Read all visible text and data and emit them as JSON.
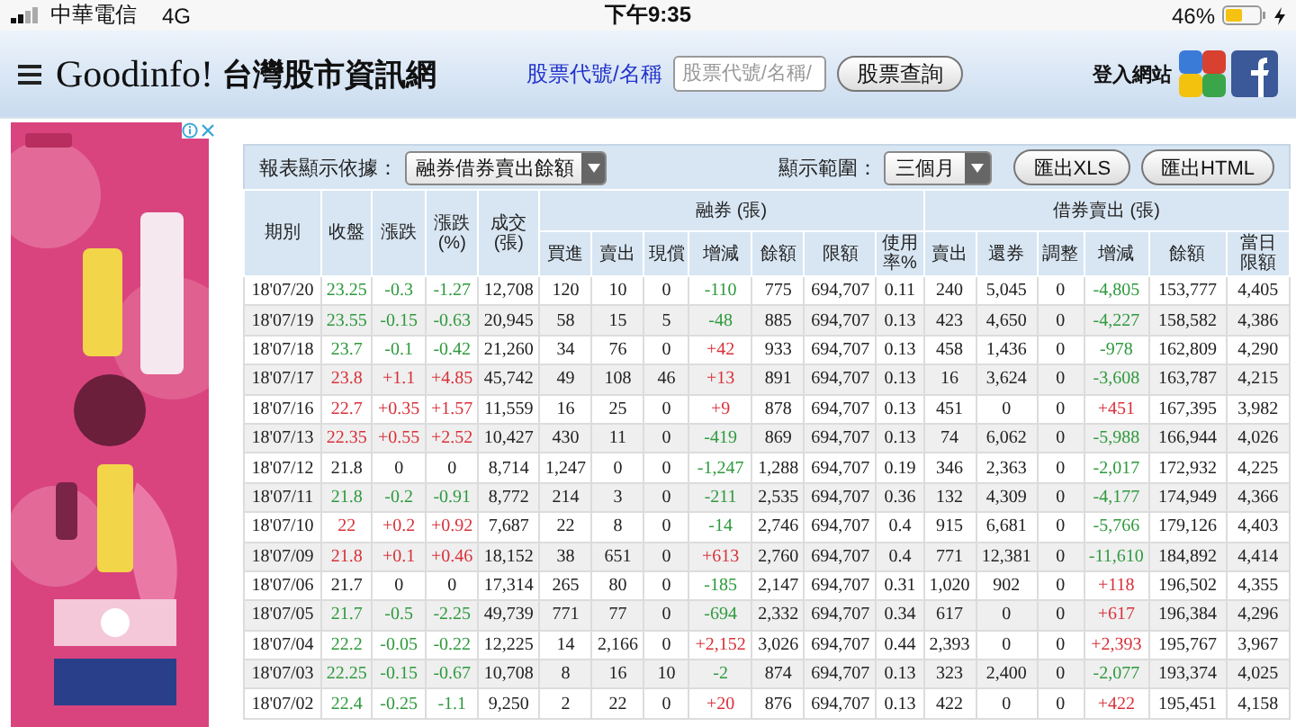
{
  "status_bar": {
    "carrier": "中華電信",
    "network": "4G",
    "time": "下午9:35",
    "battery": "46%"
  },
  "header": {
    "site_name": "Goodinfo!",
    "site_subtitle": "台灣股市資訊網",
    "search_label": "股票代號/名稱",
    "search_field": {
      "placeholder": "股票代號/名稱/"
    },
    "search_button": "股票查詢",
    "login": "登入網站"
  },
  "controls": {
    "basis_label": "報表顯示依據：",
    "basis_select": "融券借券賣出餘額",
    "range_label": "顯示範圍：",
    "range_select": "三個月",
    "buttons": [
      "匯出XLS",
      "匯出HTML"
    ]
  },
  "table": {
    "columns": [
      "期別",
      "收盤",
      "漲跌",
      "漲跌\n(%)",
      "成交\n(張)"
    ],
    "groups": [
      {
        "label": "融券 (張)",
        "columns": [
          "買進",
          "賣出",
          "現償",
          "增減",
          "餘額",
          "限額",
          "使用率%"
        ]
      },
      {
        "label": "借券賣出 (張)",
        "columns": [
          "賣出",
          "還券",
          "調整",
          "增減",
          "餘額",
          "當日限額"
        ]
      }
    ],
    "rows": [
      [
        "18'07/20",
        {
          "text": "23.25",
          "color": "#2f9a3e"
        },
        {
          "text": "-0.3",
          "color": "#2f9a3e"
        },
        {
          "text": "-1.27",
          "color": "#2f9a3e"
        },
        "12,708",
        "120",
        "10",
        "0",
        {
          "text": "-110",
          "color": "#2f9a3e"
        },
        "775",
        "694,707",
        "0.11",
        "240",
        "5,045",
        "0",
        {
          "text": "-4,805",
          "color": "#2f9a3e"
        },
        "153,777",
        "4,405"
      ],
      [
        "18'07/19",
        {
          "text": "23.55",
          "color": "#2f9a3e"
        },
        {
          "text": "-0.15",
          "color": "#2f9a3e"
        },
        {
          "text": "-0.63",
          "color": "#2f9a3e"
        },
        "20,945",
        "58",
        "15",
        "5",
        {
          "text": "-48",
          "color": "#2f9a3e"
        },
        "885",
        "694,707",
        "0.13",
        "423",
        "4,650",
        "0",
        {
          "text": "-4,227",
          "color": "#2f9a3e"
        },
        "158,582",
        "4,386"
      ],
      [
        "18'07/18",
        {
          "text": "23.7",
          "color": "#2f9a3e"
        },
        {
          "text": "-0.1",
          "color": "#2f9a3e"
        },
        {
          "text": "-0.42",
          "color": "#2f9a3e"
        },
        "21,260",
        "34",
        "76",
        "0",
        {
          "text": "+42",
          "color": "#d8323a"
        },
        "933",
        "694,707",
        "0.13",
        "458",
        "1,436",
        "0",
        {
          "text": "-978",
          "color": "#2f9a3e"
        },
        "162,809",
        "4,290"
      ],
      [
        "18'07/17",
        {
          "text": "23.8",
          "color": "#d8323a"
        },
        {
          "text": "+1.1",
          "color": "#d8323a"
        },
        {
          "text": "+4.85",
          "color": "#d8323a"
        },
        "45,742",
        "49",
        "108",
        "46",
        {
          "text": "+13",
          "color": "#d8323a"
        },
        "891",
        "694,707",
        "0.13",
        "16",
        "3,624",
        "0",
        {
          "text": "-3,608",
          "color": "#2f9a3e"
        },
        "163,787",
        "4,215"
      ],
      [
        "18'07/16",
        {
          "text": "22.7",
          "color": "#d8323a"
        },
        {
          "text": "+0.35",
          "color": "#d8323a"
        },
        {
          "text": "+1.57",
          "color": "#d8323a"
        },
        "11,559",
        "16",
        "25",
        "0",
        {
          "text": "+9",
          "color": "#d8323a"
        },
        "878",
        "694,707",
        "0.13",
        "451",
        "0",
        "0",
        {
          "text": "+451",
          "color": "#d8323a"
        },
        "167,395",
        "3,982"
      ],
      [
        "18'07/13",
        {
          "text": "22.35",
          "color": "#d8323a"
        },
        {
          "text": "+0.55",
          "color": "#d8323a"
        },
        {
          "text": "+2.52",
          "color": "#d8323a"
        },
        "10,427",
        "430",
        "11",
        "0",
        {
          "text": "-419",
          "color": "#2f9a3e"
        },
        "869",
        "694,707",
        "0.13",
        "74",
        "6,062",
        "0",
        {
          "text": "-5,988",
          "color": "#2f9a3e"
        },
        "166,944",
        "4,026"
      ],
      [
        "18'07/12",
        {
          "text": "21.8",
          "color": "#222222"
        },
        {
          "text": "0",
          "color": "#222222"
        },
        {
          "text": "0",
          "color": "#222222"
        },
        "8,714",
        "1,247",
        "0",
        "0",
        {
          "text": "-1,247",
          "color": "#2f9a3e"
        },
        "1,288",
        "694,707",
        "0.19",
        "346",
        "2,363",
        "0",
        {
          "text": "-2,017",
          "color": "#2f9a3e"
        },
        "172,932",
        "4,225"
      ],
      [
        "18'07/11",
        {
          "text": "21.8",
          "color": "#2f9a3e"
        },
        {
          "text": "-0.2",
          "color": "#2f9a3e"
        },
        {
          "text": "-0.91",
          "color": "#2f9a3e"
        },
        "8,772",
        "214",
        "3",
        "0",
        {
          "text": "-211",
          "color": "#2f9a3e"
        },
        "2,535",
        "694,707",
        "0.36",
        "132",
        "4,309",
        "0",
        {
          "text": "-4,177",
          "color": "#2f9a3e"
        },
        "174,949",
        "4,366"
      ],
      [
        "18'07/10",
        {
          "text": "22",
          "color": "#d8323a"
        },
        {
          "text": "+0.2",
          "color": "#d8323a"
        },
        {
          "text": "+0.92",
          "color": "#d8323a"
        },
        "7,687",
        "22",
        "8",
        "0",
        {
          "text": "-14",
          "color": "#2f9a3e"
        },
        "2,746",
        "694,707",
        "0.4",
        "915",
        "6,681",
        "0",
        {
          "text": "-5,766",
          "color": "#2f9a3e"
        },
        "179,126",
        "4,403"
      ],
      [
        "18'07/09",
        {
          "text": "21.8",
          "color": "#d8323a"
        },
        {
          "text": "+0.1",
          "color": "#d8323a"
        },
        {
          "text": "+0.46",
          "color": "#d8323a"
        },
        "18,152",
        "38",
        "651",
        "0",
        {
          "text": "+613",
          "color": "#d8323a"
        },
        "2,760",
        "694,707",
        "0.4",
        "771",
        "12,381",
        "0",
        {
          "text": "-11,610",
          "color": "#2f9a3e"
        },
        "184,892",
        "4,414"
      ],
      [
        "18'07/06",
        {
          "text": "21.7",
          "color": "#222222"
        },
        {
          "text": "0",
          "color": "#222222"
        },
        {
          "text": "0",
          "color": "#222222"
        },
        "17,314",
        "265",
        "80",
        "0",
        {
          "text": "-185",
          "color": "#2f9a3e"
        },
        "2,147",
        "694,707",
        "0.31",
        "1,020",
        "902",
        "0",
        {
          "text": "+118",
          "color": "#d8323a"
        },
        "196,502",
        "4,355"
      ],
      [
        "18'07/05",
        {
          "text": "21.7",
          "color": "#2f9a3e"
        },
        {
          "text": "-0.5",
          "color": "#2f9a3e"
        },
        {
          "text": "-2.25",
          "color": "#2f9a3e"
        },
        "49,739",
        "771",
        "77",
        "0",
        {
          "text": "-694",
          "color": "#2f9a3e"
        },
        "2,332",
        "694,707",
        "0.34",
        "617",
        "0",
        "0",
        {
          "text": "+617",
          "color": "#d8323a"
        },
        "196,384",
        "4,296"
      ],
      [
        "18'07/04",
        {
          "text": "22.2",
          "color": "#2f9a3e"
        },
        {
          "text": "-0.05",
          "color": "#2f9a3e"
        },
        {
          "text": "-0.22",
          "color": "#2f9a3e"
        },
        "12,225",
        "14",
        "2,166",
        "0",
        {
          "text": "+2,152",
          "color": "#d8323a"
        },
        "3,026",
        "694,707",
        "0.44",
        "2,393",
        "0",
        "0",
        {
          "text": "+2,393",
          "color": "#d8323a"
        },
        "195,767",
        "3,967"
      ],
      [
        "18'07/03",
        {
          "text": "22.25",
          "color": "#2f9a3e"
        },
        {
          "text": "-0.15",
          "color": "#2f9a3e"
        },
        {
          "text": "-0.67",
          "color": "#2f9a3e"
        },
        "10,708",
        "8",
        "16",
        "10",
        {
          "text": "-2",
          "color": "#2f9a3e"
        },
        "874",
        "694,707",
        "0.13",
        "323",
        "2,400",
        "0",
        {
          "text": "-2,077",
          "color": "#2f9a3e"
        },
        "193,374",
        "4,025"
      ],
      [
        "18'07/02",
        {
          "text": "22.4",
          "color": "#2f9a3e"
        },
        {
          "text": "-0.25",
          "color": "#2f9a3e"
        },
        {
          "text": "-1.1",
          "color": "#2f9a3e"
        },
        "9,250",
        "2",
        "22",
        "0",
        {
          "text": "+20",
          "color": "#d8323a"
        },
        "876",
        "694,707",
        "0.13",
        "422",
        "0",
        "0",
        {
          "text": "+422",
          "color": "#d8323a"
        },
        "195,451",
        "4,158"
      ]
    ]
  }
}
